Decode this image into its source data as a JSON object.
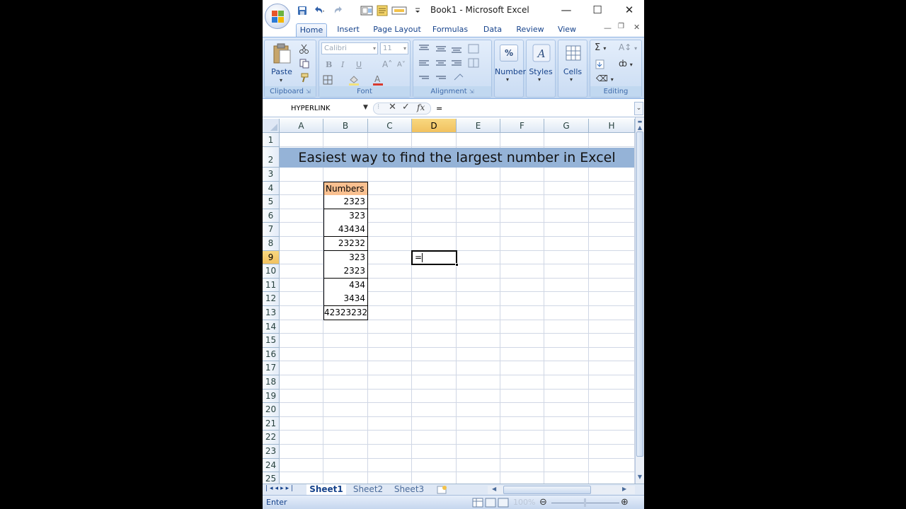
{
  "window": {
    "title": "Book1 - Microsoft Excel"
  },
  "tabs": [
    "Home",
    "Insert",
    "Page Layout",
    "Formulas",
    "Data",
    "Review",
    "View"
  ],
  "ribbon": {
    "clipboard": {
      "label": "Clipboard",
      "paste": "Paste"
    },
    "font": {
      "label": "Font",
      "font_name": "Calibri",
      "font_size": "11"
    },
    "alignment": {
      "label": "Alignment"
    },
    "number": {
      "label": "Number",
      "icon_text": "%"
    },
    "styles": {
      "label": "Styles"
    },
    "cells": {
      "label": "Cells"
    },
    "editing": {
      "label": "Editing"
    }
  },
  "formula_bar": {
    "name_box": "HYPERLINK",
    "fx": "fx",
    "formula": "="
  },
  "columns": [
    "A",
    "B",
    "C",
    "D",
    "E",
    "F",
    "G",
    "H"
  ],
  "rows": [
    "1",
    "2",
    "3",
    "4",
    "5",
    "6",
    "7",
    "8",
    "9",
    "10",
    "11",
    "12",
    "13",
    "14",
    "15",
    "16",
    "17",
    "18",
    "19",
    "20",
    "21",
    "22",
    "23",
    "24",
    "25"
  ],
  "selected_column": "D",
  "selected_row": "9",
  "sheet": {
    "banner": "Easiest way to find the largest number in Excel",
    "numbers_header": "Numbers",
    "numbers": [
      "2323",
      "323",
      "43434",
      "23232",
      "323",
      "2323",
      "434",
      "3434",
      "42323232"
    ],
    "active_cell_text": "="
  },
  "sheet_tabs": [
    "Sheet1",
    "Sheet2",
    "Sheet3"
  ],
  "status": {
    "mode": "Enter",
    "zoom": "100%"
  },
  "colors": {
    "banner": "#95b3d7",
    "header_fill": "#fac090",
    "selected_header": "#f1c15f"
  }
}
